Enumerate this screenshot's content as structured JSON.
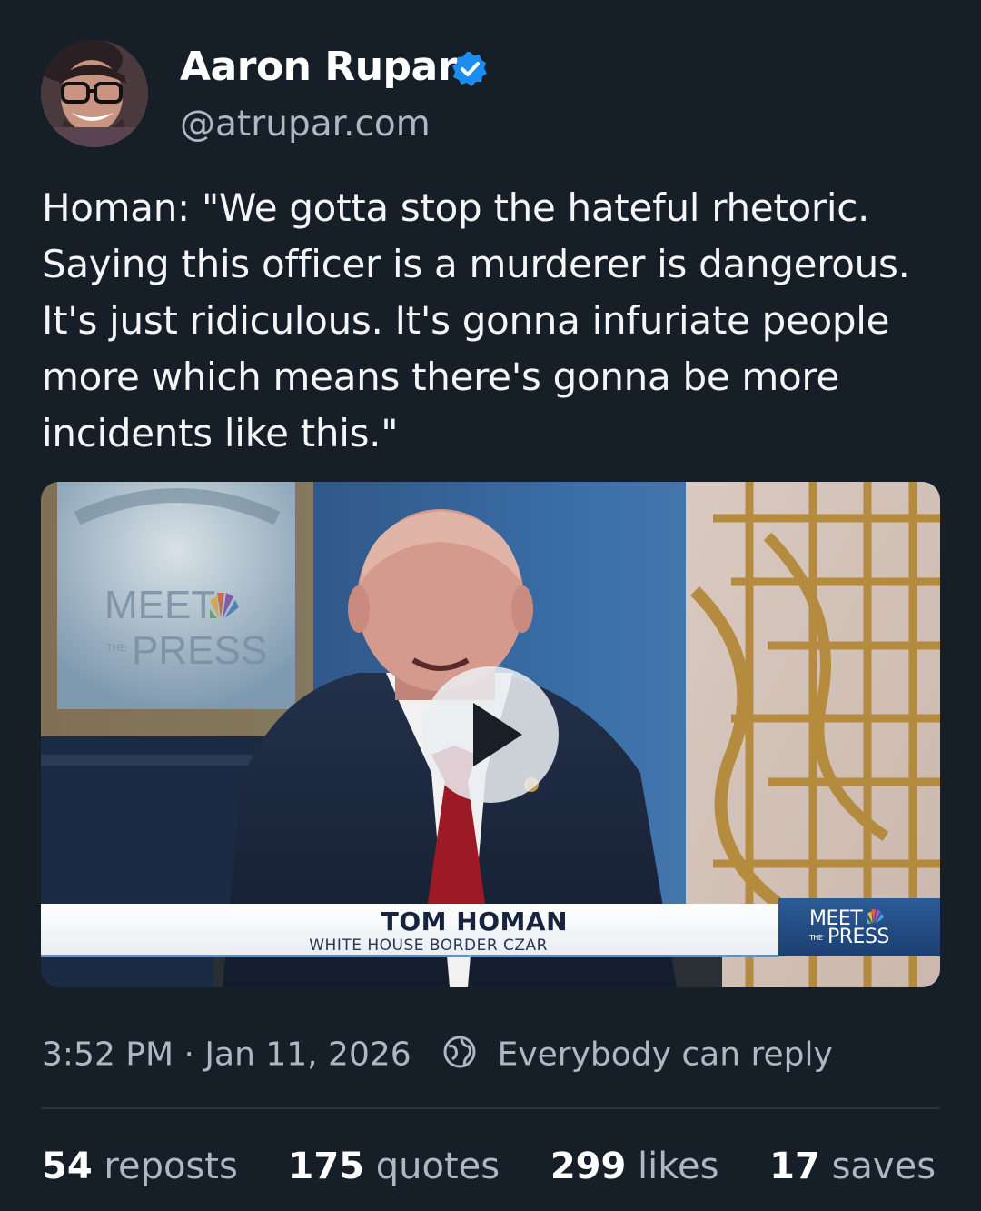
{
  "author": {
    "name": "Aaron Rupar",
    "handle": "@atrupar.com",
    "verified": true,
    "verified_color": "#1d8cf0"
  },
  "post": {
    "text": "Homan: \"We gotta stop the hateful rhetoric. Saying this officer is a murderer is dangerous. It's just ridiculous. It's gonna infuriate people more which means there's gonna be more incidents like this.\""
  },
  "video": {
    "background_logo_line1": "MEET",
    "background_logo_line2": "PRESS",
    "background_logo_small": "THE",
    "lower_third_name": "TOM HOMAN",
    "lower_third_title": "WHITE HOUSE BORDER CZAR",
    "corner_logo_line1": "MEET",
    "corner_logo_small": "THE",
    "corner_logo_line2": "PRESS",
    "play_icon": "play-icon"
  },
  "meta": {
    "time": "3:52 PM",
    "separator": "·",
    "date": "Jan 11, 2026",
    "reply_setting": "Everybody can reply",
    "reply_icon": "globe-icon"
  },
  "stats": [
    {
      "count": "54",
      "label": "reposts"
    },
    {
      "count": "175",
      "label": "quotes"
    },
    {
      "count": "299",
      "label": "likes"
    },
    {
      "count": "17",
      "label": "saves"
    }
  ],
  "colors": {
    "background": "#161e27",
    "text_primary": "#f3f5f7",
    "text_secondary": "#aeb7c2",
    "divider": "#2a333e"
  }
}
